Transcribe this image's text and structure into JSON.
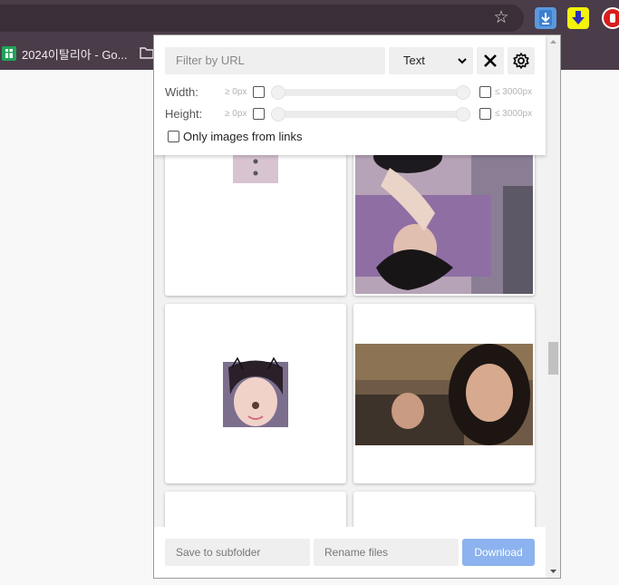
{
  "bookmarks": [
    {
      "label": "2024이탈리아 - Go..."
    }
  ],
  "filters": {
    "url_placeholder": "Filter by URL",
    "type_selected": "Text",
    "width_label": "Width:",
    "height_label": "Height:",
    "min_label": "≥ 0px",
    "max_label": "≤ 3000px",
    "only_links_label": "Only images from links"
  },
  "footer": {
    "subfolder_placeholder": "Save to subfolder",
    "rename_placeholder": "Rename files",
    "download_label": "Download"
  },
  "colors": {
    "chrome_dark": "#4a3c48",
    "download_button": "#8cb3ef",
    "extension_active": "#5b98dd"
  },
  "icons": [
    "star-icon",
    "download-extension-icon",
    "yellow-download-extension-icon",
    "red-hand-extension-icon",
    "sheets-icon",
    "folder-icon",
    "close-icon",
    "gear-icon",
    "chevron-down-icon"
  ]
}
